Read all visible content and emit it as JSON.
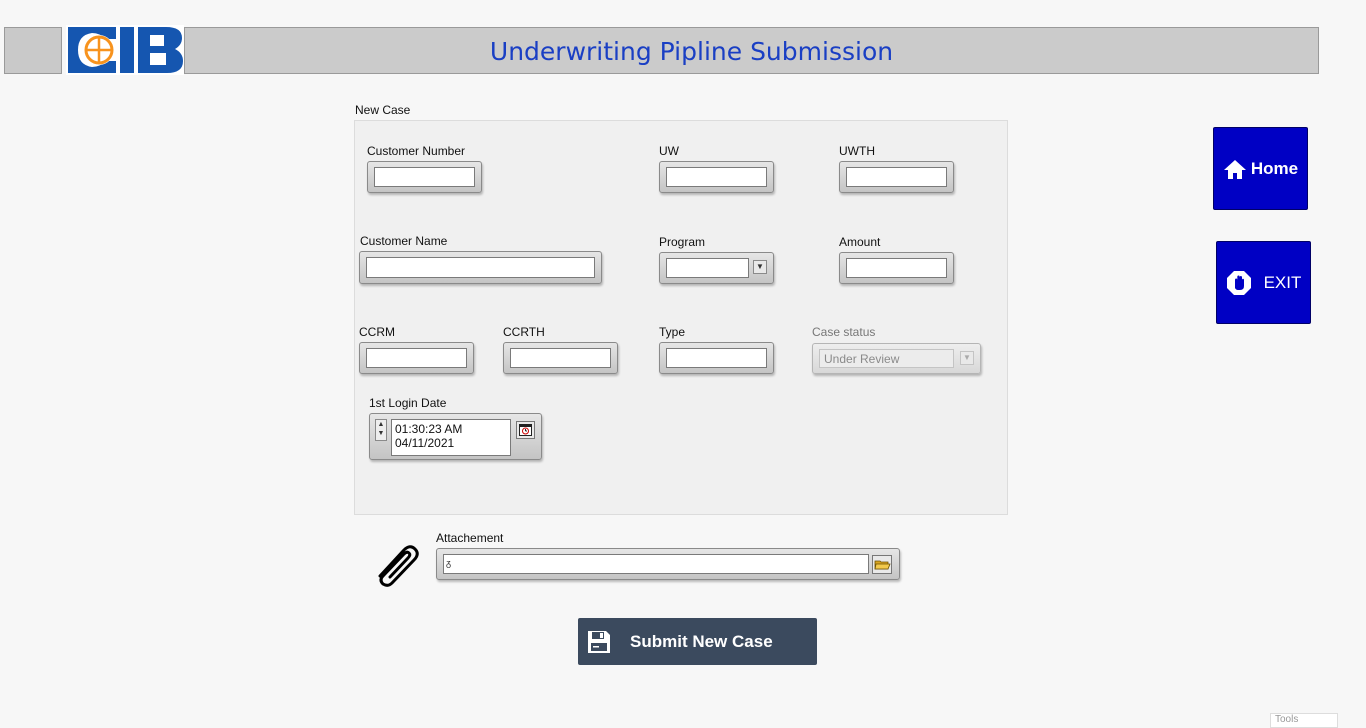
{
  "header": {
    "title": "Underwriting Pipline Submission",
    "logo_text": "CIB"
  },
  "form": {
    "section_label": "New Case",
    "customer_number": {
      "label": "Customer Number",
      "value": ""
    },
    "uw": {
      "label": "UW",
      "value": ""
    },
    "uwth": {
      "label": "UWTH",
      "value": ""
    },
    "customer_name": {
      "label": "Customer Name",
      "value": ""
    },
    "program": {
      "label": "Program",
      "value": ""
    },
    "amount": {
      "label": "Amount",
      "value": ""
    },
    "ccrm": {
      "label": "CCRM",
      "value": ""
    },
    "ccrth": {
      "label": "CCRTH",
      "value": ""
    },
    "type": {
      "label": "Type",
      "value": ""
    },
    "case_status": {
      "label": "Case status",
      "value": "Under Review"
    },
    "login_date": {
      "label": "1st Login Date",
      "time": "01:30:23 AM",
      "date": "04/11/2021"
    }
  },
  "attachment": {
    "label": "Attachement",
    "value": ""
  },
  "buttons": {
    "home": "Home",
    "exit": "EXIT",
    "submit": "Submit New Case"
  },
  "tools": {
    "label": "Tools"
  },
  "colors": {
    "title": "#1a3fc4",
    "side_buttons": "#0000c4",
    "submit": "#3b4a5e"
  }
}
